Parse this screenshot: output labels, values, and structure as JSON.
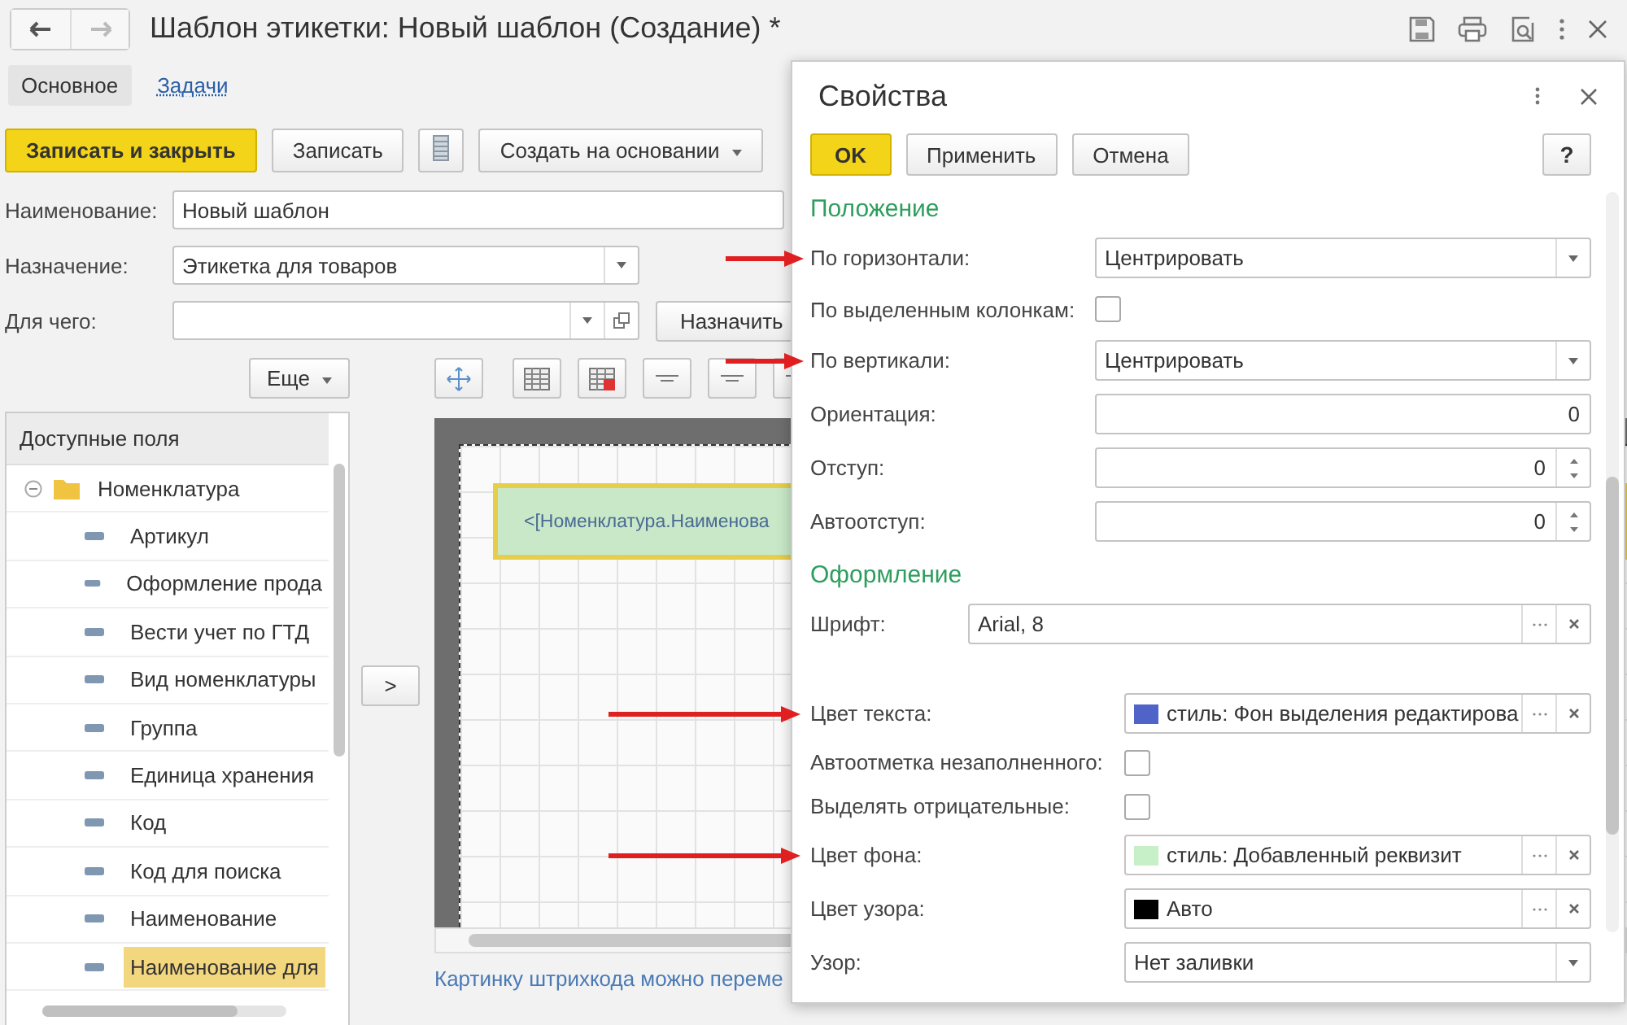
{
  "window": {
    "title": "Шаблон этикетки: Новый шаблон (Создание) *",
    "tabs": [
      {
        "label": "Основное",
        "selected": true
      },
      {
        "label": "Задачи",
        "selected": false
      }
    ]
  },
  "toolbar": [
    {
      "kind": "primary",
      "label": "Записать и закрыть"
    },
    {
      "kind": "normal",
      "label": "Записать"
    },
    {
      "kind": "icon"
    },
    {
      "kind": "menu",
      "label": "Создать на основании"
    }
  ],
  "fields": [
    {
      "kind": "text",
      "label": "Наименование:",
      "value": "Новый шаблон"
    },
    {
      "kind": "select",
      "label": "Назначение:",
      "value": "Этикетка для товаров"
    },
    {
      "kind": "lookup",
      "label": "Для чего:",
      "button": "Назначить"
    }
  ],
  "fields_panel": {
    "more_button": "Еще",
    "header": "Доступные поля",
    "tree": [
      {
        "label": "Номенклатура",
        "expanded": true,
        "children": [
          {
            "label": "Артикул",
            "selected": false
          },
          {
            "label": "Оформление прода",
            "selected": false
          },
          {
            "label": "Вести учет по ГТД",
            "selected": false
          },
          {
            "label": "Вид номенклатуры",
            "selected": false
          },
          {
            "label": "Группа",
            "selected": false
          },
          {
            "label": "Единица хранения",
            "selected": false
          },
          {
            "label": "Код",
            "selected": false
          },
          {
            "label": "Код для поиска",
            "selected": false
          },
          {
            "label": "Наименование",
            "selected": false
          },
          {
            "label": "Наименование для",
            "selected": true
          }
        ]
      }
    ]
  },
  "move_button": ">",
  "canvas": {
    "element_text": "<[Номенклатура.Наименова"
  },
  "hint": "Картинку штрихкода можно переме",
  "dialog": {
    "title": "Свойства",
    "buttons": [
      {
        "kind": "primary",
        "label": "OK"
      },
      {
        "kind": "normal",
        "label": "Применить"
      },
      {
        "kind": "normal",
        "label": "Отмена"
      }
    ],
    "help": "?",
    "sections": [
      {
        "title": "Положение",
        "rows": [
          {
            "kind": "select",
            "label": "По горизонтали:",
            "value": "Центрировать",
            "arrow": true
          },
          {
            "kind": "checkbox",
            "label": "По выделенным колонкам:",
            "checked": false
          },
          {
            "kind": "select",
            "label": "По вертикали:",
            "value": "Центрировать",
            "arrow": true
          },
          {
            "kind": "number",
            "label": "Ориентация:",
            "value": "0"
          },
          {
            "kind": "spin",
            "label": "Отступ:",
            "value": "0"
          },
          {
            "kind": "spin",
            "label": "Автоотступ:",
            "value": "0"
          }
        ]
      },
      {
        "title": "Оформление",
        "rows": [
          {
            "kind": "picker",
            "label": "Шрифт:",
            "value": "Arial, 8"
          },
          {
            "kind": "color",
            "label": "Цвет текста:",
            "value": "стиль: Фон выделения редактирова",
            "color": "#4f63c8",
            "arrow": true
          },
          {
            "kind": "checkbox",
            "label": "Автоотметка незаполненного:",
            "checked": false
          },
          {
            "kind": "checkbox",
            "label": "Выделять отрицательные:",
            "checked": false
          },
          {
            "kind": "color",
            "label": "Цвет фона:",
            "value": "стиль: Добавленный реквизит",
            "color": "#c8f0c8",
            "arrow": true
          },
          {
            "kind": "color",
            "label": "Цвет узора:",
            "value": "Авто",
            "color": "#000000"
          },
          {
            "kind": "select",
            "label": "Узор:",
            "value": "Нет заливки"
          }
        ]
      }
    ]
  }
}
